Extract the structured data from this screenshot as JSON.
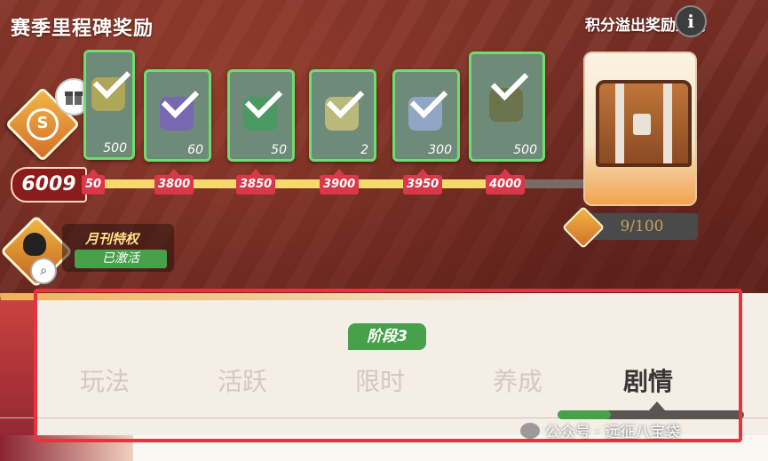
{
  "header": {
    "title": "赛季里程碑奖励",
    "rules_label": "积分溢出奖励规则",
    "info_glyph": "i"
  },
  "score": {
    "value": "6009"
  },
  "milestones": [
    {
      "points": "50",
      "count": "500",
      "claimed": true,
      "icon": "coin-ticket-icon"
    },
    {
      "points": "3800",
      "count": "60",
      "claimed": true,
      "icon": "purple-orb-icon"
    },
    {
      "points": "3850",
      "count": "50",
      "claimed": true,
      "icon": "green-gem-icon"
    },
    {
      "points": "3900",
      "count": "2",
      "claimed": true,
      "icon": "yellow-ticket-icon"
    },
    {
      "points": "3950",
      "count": "300",
      "claimed": true,
      "icon": "diamond-icon"
    },
    {
      "points": "4000",
      "count": "500",
      "claimed": true,
      "icon": "gold-coin-card-icon"
    }
  ],
  "chest": {
    "progress": "9/100",
    "icon": "treasure-chest-icon"
  },
  "privilege": {
    "title": "月刊特权",
    "status": "已激活"
  },
  "stage": {
    "label": "阶段3"
  },
  "tabs": [
    {
      "label": "玩法",
      "active": false
    },
    {
      "label": "活跃",
      "active": false
    },
    {
      "label": "限时",
      "active": false
    },
    {
      "label": "养成",
      "active": false
    },
    {
      "label": "剧情",
      "active": true
    }
  ],
  "watermark": {
    "text": "公众号 · 远征八宝袋"
  },
  "colors": {
    "accent_green": "#46a14a",
    "milestone_red": "#d8384a",
    "track_yellow": "#f6d96c",
    "highlight_red": "#e8323f"
  }
}
